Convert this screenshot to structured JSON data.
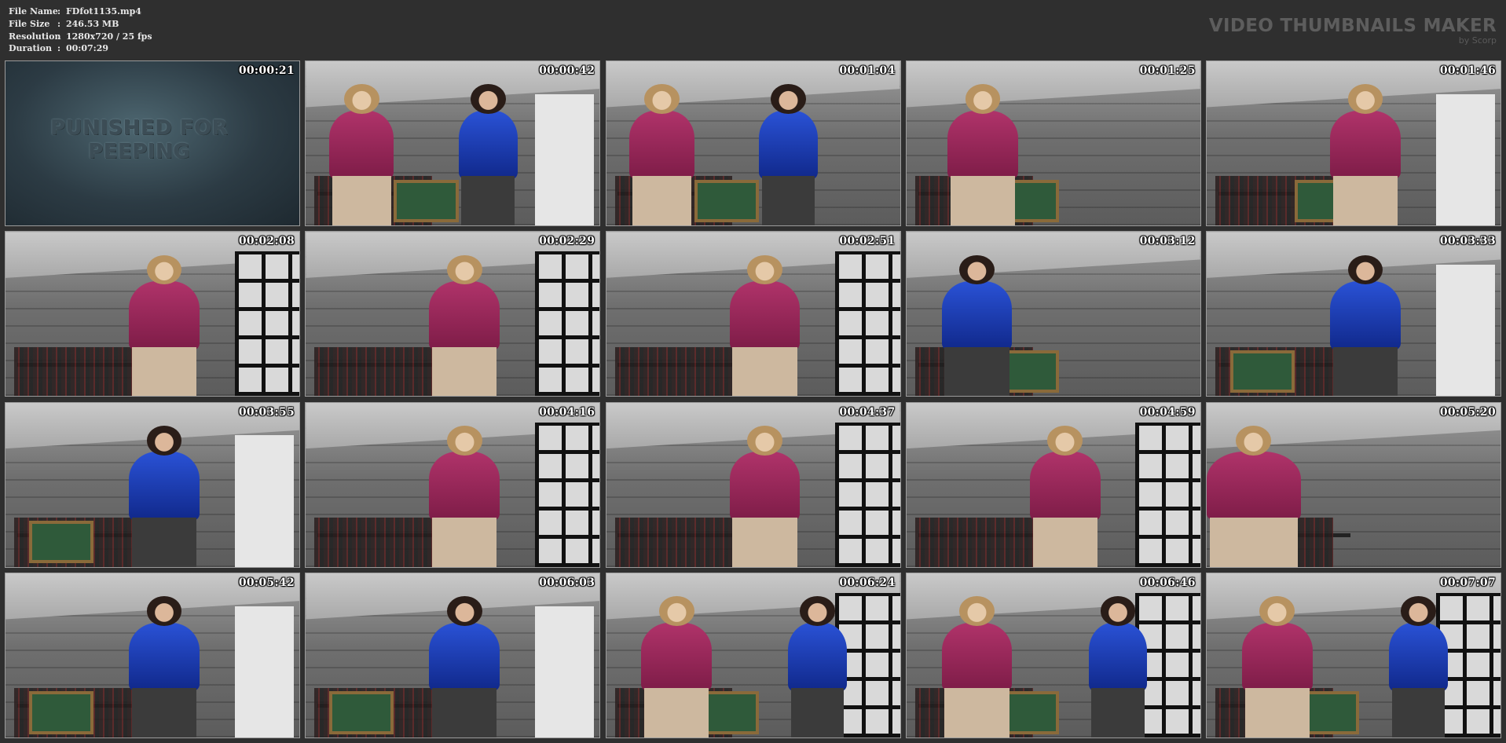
{
  "file_info": {
    "rows": [
      {
        "key": "File Name",
        "sep": ":",
        "value": "FDfot1135.mp4"
      },
      {
        "key": "File Size",
        "sep": ":",
        "value": "246.53 MB"
      },
      {
        "key": "Resolution",
        "sep": ":",
        "value": "1280x720 / 25 fps"
      },
      {
        "key": "Duration",
        "sep": ":",
        "value": "00:07:29"
      }
    ]
  },
  "brand": {
    "title": "VIDEO THUMBNAILS MAKER",
    "subtitle": "by Scorp"
  },
  "intro": {
    "title": "PUNISHED FOR PEEPING"
  },
  "thumbnails": [
    {
      "time": "00:00:21"
    },
    {
      "time": "00:00:42"
    },
    {
      "time": "00:01:04"
    },
    {
      "time": "00:01:25"
    },
    {
      "time": "00:01:46"
    },
    {
      "time": "00:02:08"
    },
    {
      "time": "00:02:29"
    },
    {
      "time": "00:02:51"
    },
    {
      "time": "00:03:12"
    },
    {
      "time": "00:03:33"
    },
    {
      "time": "00:03:55"
    },
    {
      "time": "00:04:16"
    },
    {
      "time": "00:04:37"
    },
    {
      "time": "00:04:59"
    },
    {
      "time": "00:05:20"
    },
    {
      "time": "00:05:42"
    },
    {
      "time": "00:06:03"
    },
    {
      "time": "00:06:24"
    },
    {
      "time": "00:06:46"
    },
    {
      "time": "00:07:07"
    }
  ]
}
